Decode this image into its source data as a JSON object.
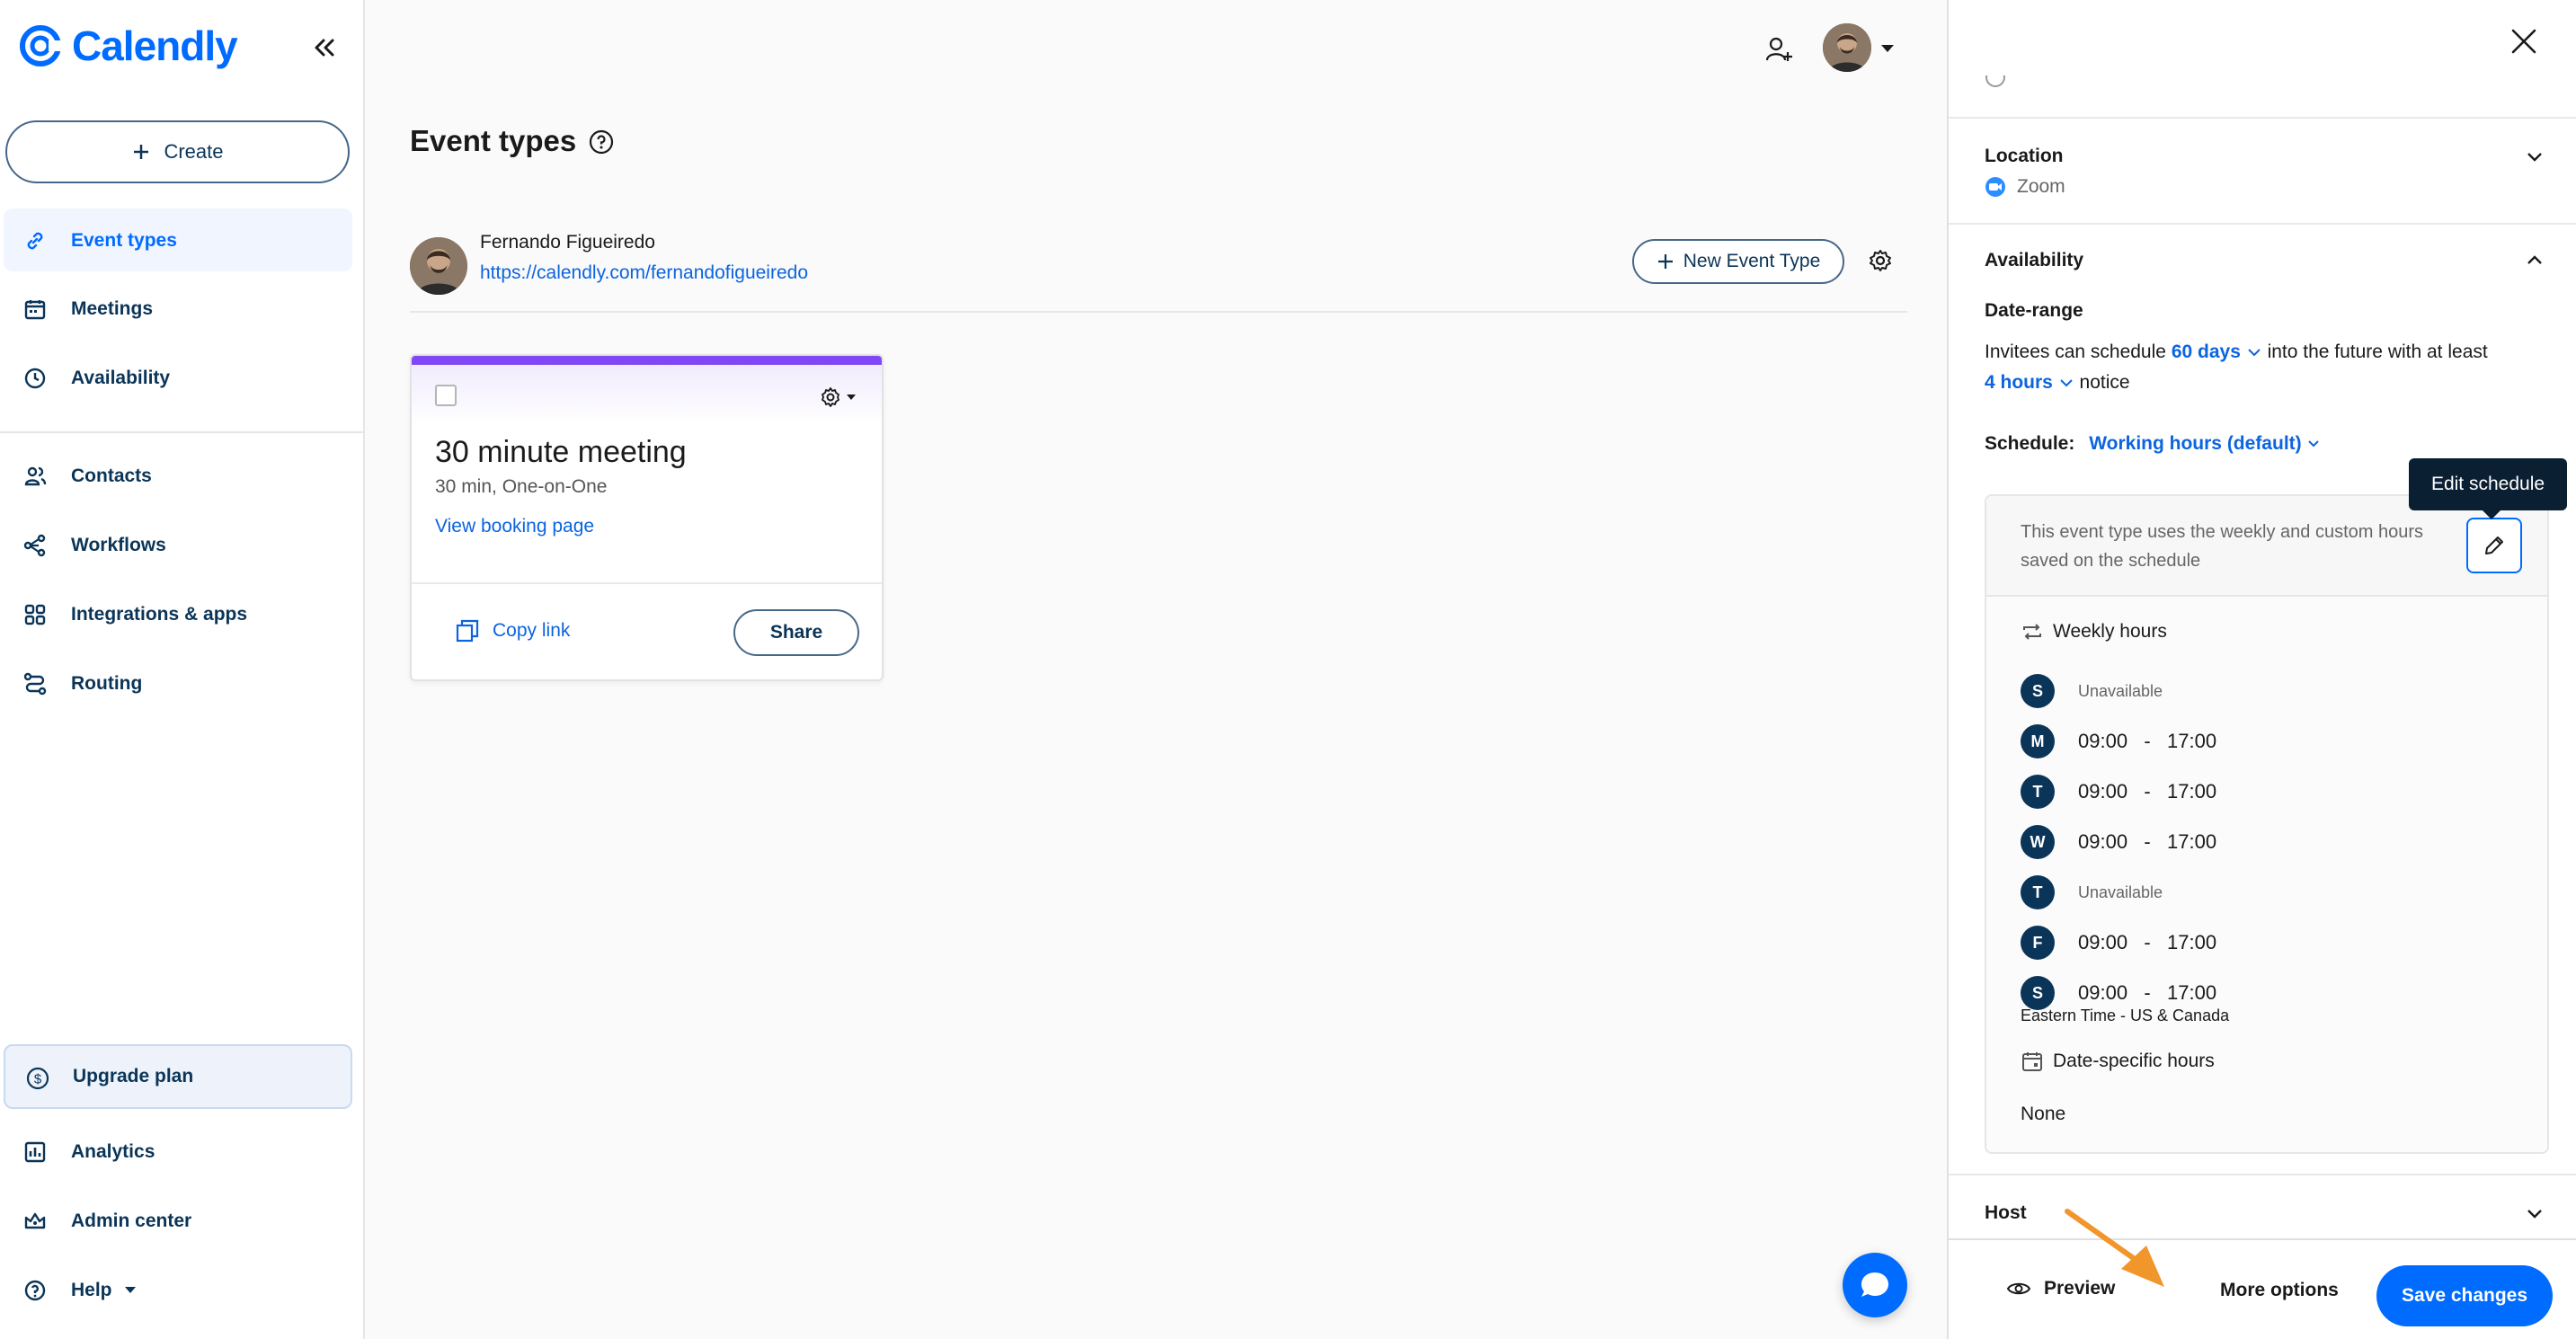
{
  "app": {
    "logo_text": "Calendly"
  },
  "sidebar": {
    "create_label": "Create",
    "items": [
      {
        "label": "Event types",
        "icon": "link-icon",
        "active": true
      },
      {
        "label": "Meetings",
        "icon": "calendar-icon"
      },
      {
        "label": "Availability",
        "icon": "clock-icon"
      },
      {
        "label": "Contacts",
        "icon": "contacts-icon"
      },
      {
        "label": "Workflows",
        "icon": "workflow-icon"
      },
      {
        "label": "Integrations & apps",
        "icon": "grid-icon"
      },
      {
        "label": "Routing",
        "icon": "routing-icon"
      }
    ],
    "upgrade_label": "Upgrade plan",
    "bottom_items": [
      {
        "label": "Analytics",
        "icon": "analytics-icon"
      },
      {
        "label": "Admin center",
        "icon": "crown-icon"
      },
      {
        "label": "Help",
        "icon": "help-icon"
      }
    ]
  },
  "main": {
    "title": "Event types",
    "user": {
      "name": "Fernando Figueiredo",
      "url": "https://calendly.com/fernandofigueiredo"
    },
    "new_event_label": "New Event Type",
    "card": {
      "title": "30 minute meeting",
      "subtitle": "30 min, One-on-One",
      "booking_link": "View booking page",
      "copy_label": "Copy link",
      "share_label": "Share",
      "accent_color": "#8247f5"
    }
  },
  "panel": {
    "location": {
      "title": "Location",
      "value": "Zoom"
    },
    "availability": {
      "title": "Availability",
      "date_range_title": "Date-range",
      "line1_prefix": "Invitees can schedule",
      "days_value": "60 days",
      "line1_suffix": "into the future with at least",
      "hours_value": "4 hours",
      "line2_suffix": "notice",
      "schedule_label": "Schedule:",
      "schedule_value": "Working hours (default)",
      "edit_tooltip": "Edit schedule",
      "description": "This event type uses the weekly and custom hours saved on the schedule",
      "weekly_title": "Weekly hours",
      "days": [
        {
          "letter": "S",
          "text": "Unavailable",
          "unavailable": true
        },
        {
          "letter": "M",
          "text": "09:00   -   17:00"
        },
        {
          "letter": "T",
          "text": "09:00   -   17:00"
        },
        {
          "letter": "W",
          "text": "09:00   -   17:00"
        },
        {
          "letter": "T",
          "text": "Unavailable",
          "unavailable": true
        },
        {
          "letter": "F",
          "text": "09:00   -   17:00"
        },
        {
          "letter": "S",
          "text": "09:00   -   17:00"
        }
      ],
      "timezone": "Eastern Time - US & Canada",
      "date_specific_title": "Date-specific hours",
      "date_specific_value": "None"
    },
    "host": {
      "title": "Host"
    },
    "footer": {
      "preview_label": "Preview",
      "more_options_label": "More options",
      "save_label": "Save changes"
    }
  },
  "colors": {
    "brand": "#006bff",
    "dark_navy": "#0b3558",
    "annotation_arrow": "#f0962a"
  }
}
